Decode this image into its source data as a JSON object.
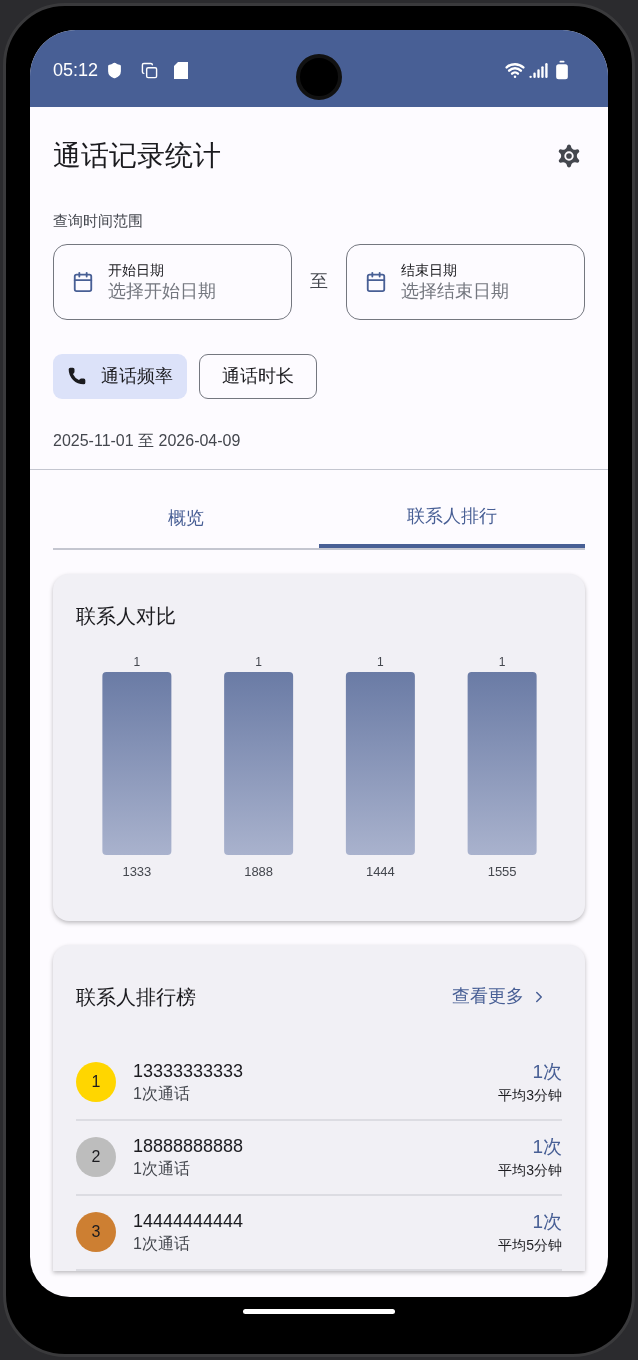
{
  "status_bar": {
    "time": "05:12"
  },
  "header": {
    "title": "通话记录统计"
  },
  "date_range": {
    "label": "查询时间范围",
    "separator": "至",
    "start": {
      "label": "开始日期",
      "placeholder": "选择开始日期"
    },
    "end": {
      "label": "结束日期",
      "placeholder": "选择结束日期"
    }
  },
  "filter_chips": [
    {
      "label": "通话频率",
      "selected": true
    },
    {
      "label": "通话时长",
      "selected": false
    }
  ],
  "range_text": "2025-11-01 至 2026-04-09",
  "tabs": [
    {
      "label": "概览",
      "selected": false
    },
    {
      "label": "联系人排行",
      "selected": true
    }
  ],
  "comparison_card": {
    "title": "联系人对比",
    "chart_data": {
      "type": "bar",
      "categories": [
        "1333",
        "1888",
        "1444",
        "1555"
      ],
      "values": [
        1,
        1,
        1,
        1
      ],
      "data_labels": true
    }
  },
  "ranking_card": {
    "title": "联系人排行榜",
    "more_link": "查看更多",
    "rows": [
      {
        "rank": "1",
        "color": "#ffd600",
        "number": "13333333333",
        "calls": "1次通话",
        "count": "1次",
        "average": "平均3分钟"
      },
      {
        "rank": "2",
        "color": "#bdbdbd",
        "number": "18888888888",
        "calls": "1次通话",
        "count": "1次",
        "average": "平均3分钟"
      },
      {
        "rank": "3",
        "color": "#cd7f32",
        "number": "14444444444",
        "calls": "1次通话",
        "count": "1次",
        "average": "平均5分钟"
      }
    ]
  }
}
